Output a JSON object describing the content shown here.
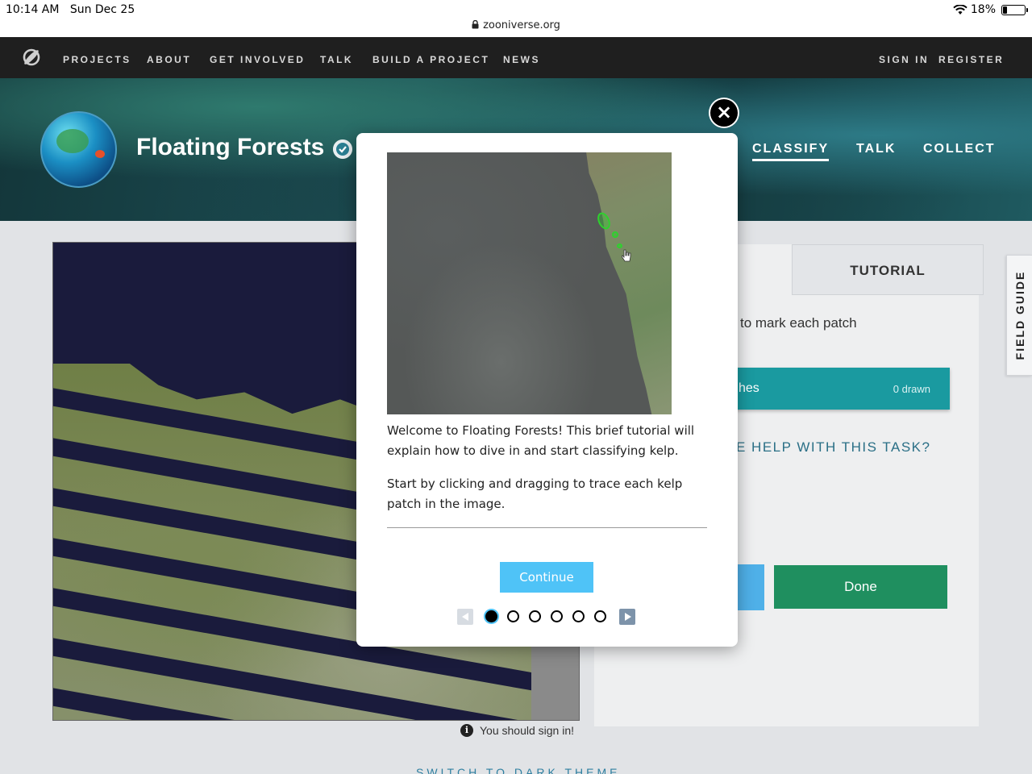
{
  "status_bar": {
    "time": "10:14 AM",
    "date": "Sun Dec 25",
    "url": "zooniverse.org",
    "battery": "18%",
    "battery_level": 0.18
  },
  "nav": {
    "items": [
      "PROJECTS",
      "ABOUT",
      "GET INVOLVED",
      "TALK",
      "BUILD A PROJECT",
      "NEWS"
    ],
    "sign_in": "SIGN IN",
    "register": "REGISTER"
  },
  "project": {
    "title": "Floating Forests",
    "tabs": [
      "CLASSIFY",
      "TALK",
      "COLLECT"
    ],
    "active_tab": "CLASSIFY"
  },
  "task": {
    "tabs": [
      "TUTORIAL"
    ],
    "instruction": "to mark each patch",
    "tool_label": "hes",
    "tool_count": "0 drawn",
    "help_link": "E HELP WITH THIS TASK?",
    "done_label": "Done"
  },
  "field_guide": "FIELD GUIDE",
  "sign_in_note": "You should sign in!",
  "dark_theme_link": "SWITCH TO DARK THEME",
  "tutorial": {
    "paragraphs": [
      "Welcome to Floating Forests! This brief tutorial will explain how to dive in and start classifying kelp.",
      "Start by clicking and dragging to trace each kelp patch in the image."
    ],
    "continue_label": "Continue",
    "close_symbol": "×",
    "total_steps": 6,
    "current_step": 1
  },
  "colors": {
    "nav_bg": "#1f1f1f",
    "continue_blue": "#4fc3f7",
    "tool_teal": "#1a9aa0",
    "done_green": "#1f8f5f",
    "kelp_outline": "#2ed12e"
  }
}
